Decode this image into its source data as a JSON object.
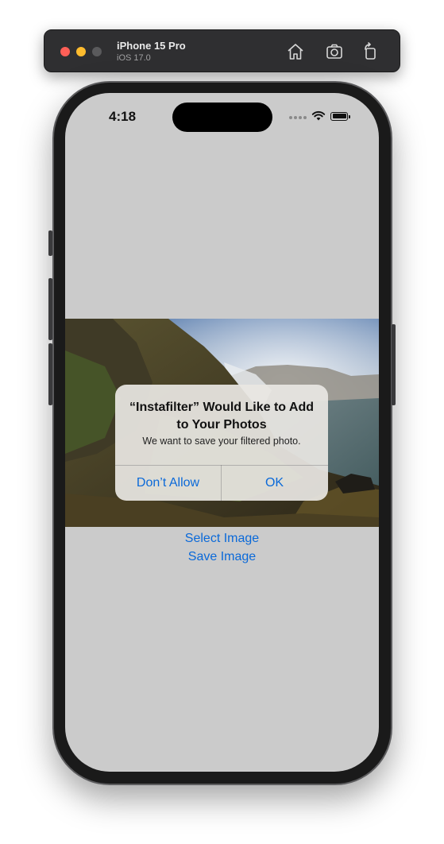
{
  "simulator": {
    "device_name": "iPhone 15 Pro",
    "os_version": "iOS 17.0",
    "icons": [
      "home-icon",
      "screenshot-icon",
      "rotate-icon"
    ]
  },
  "status_bar": {
    "time": "4:18",
    "icons": [
      "signal-dots-icon",
      "wifi-icon",
      "battery-icon"
    ]
  },
  "main": {
    "image_alt_icon": "waterfall-photo",
    "select_image_label": "Select Image",
    "save_image_label": "Save Image"
  },
  "alert": {
    "title": "“Instafilter” Would Like to Add to Your Photos",
    "message": "We want to save your filtered photo.",
    "dont_allow_label": "Don’t Allow",
    "ok_label": "OK"
  },
  "colors": {
    "accent": "#0a69d9",
    "screen_background": "#cbcbcb",
    "titlebar": "#2f2f31"
  }
}
